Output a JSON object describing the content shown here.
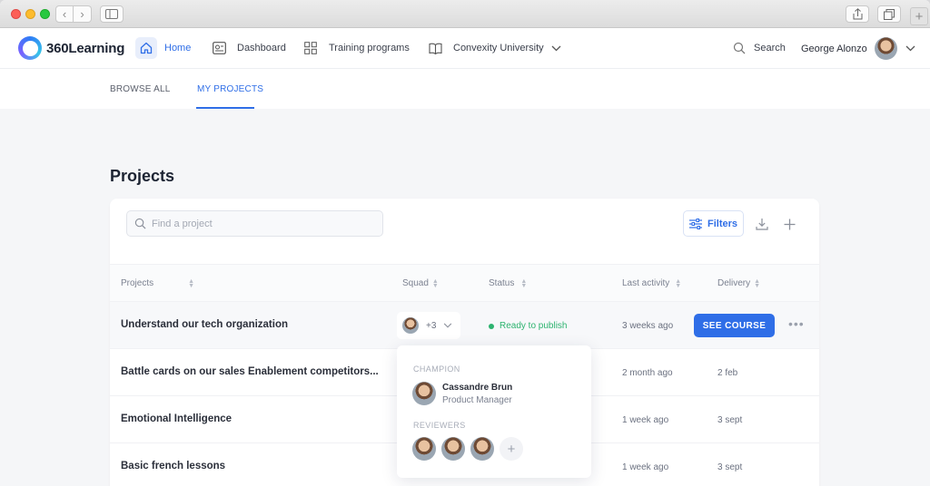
{
  "app": {
    "brand": "360Learning",
    "brand_color": "#2f6ee7"
  },
  "nav": {
    "home": "Home",
    "dashboard": "Dashboard",
    "training": "Training programs",
    "university": "Convexity University",
    "search": "Search",
    "user": "George Alonzo"
  },
  "subtabs": {
    "browse_all": "BROWSE ALL",
    "my_projects": "MY PROJECTS"
  },
  "page": {
    "title": "Projects"
  },
  "toolbar": {
    "search_placeholder": "Find a project",
    "filters": "Filters"
  },
  "table": {
    "headers": {
      "projects": "Projects",
      "squad": "Squad",
      "status": "Status",
      "last_activity": "Last activity",
      "delivery": "Delivery"
    },
    "rows": [
      {
        "name": "Understand our tech organization",
        "squad_count": "+3",
        "status": "Ready to publish",
        "last_activity": "3 weeks ago",
        "action": "SEE COURSE"
      },
      {
        "name": "Battle cards on our sales Enablement competitors...",
        "last_activity": "2 month ago",
        "delivery": "2 feb"
      },
      {
        "name": "Emotional Intelligence",
        "last_activity": "1 week ago",
        "delivery": "3 sept"
      },
      {
        "name": "Basic french lessons",
        "last_activity": "1 week ago",
        "delivery": "3 sept"
      }
    ]
  },
  "popover": {
    "champion_label": "CHAMPION",
    "champion_name": "Cassandre Brun",
    "champion_role": "Product Manager",
    "reviewers_label": "REVIEWERS"
  }
}
